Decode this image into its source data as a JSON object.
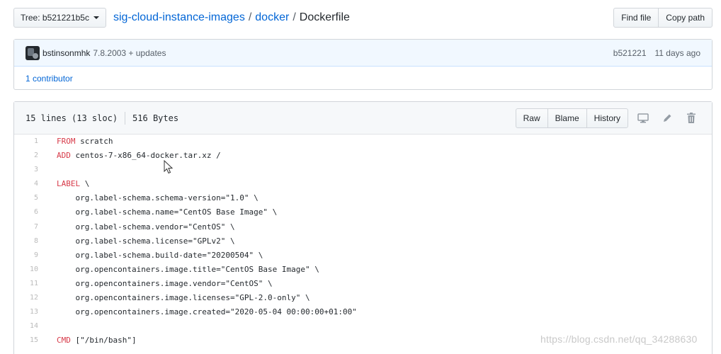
{
  "topbar": {
    "tree_label": "Tree: b521221b5c",
    "repo": "sig-cloud-instance-images",
    "dir": "docker",
    "file": "Dockerfile",
    "separator": "/",
    "find_file": "Find file",
    "copy_path": "Copy path"
  },
  "commit": {
    "author": "bstinsonmhk",
    "message": "7.8.2003 + updates",
    "sha": "b521221",
    "time": "11 days ago",
    "contributors": "1 contributor"
  },
  "file": {
    "lines_info": "15 lines (13 sloc)",
    "size": "516 Bytes",
    "raw": "Raw",
    "blame": "Blame",
    "history": "History",
    "icons": [
      "desktop-icon",
      "pencil-icon",
      "trash-icon"
    ]
  },
  "code_lines": [
    {
      "n": "1",
      "kw": "FROM",
      "rest": " scratch"
    },
    {
      "n": "2",
      "kw": "ADD",
      "rest": " centos-7-x86_64-docker.tar.xz /"
    },
    {
      "n": "3",
      "kw": "",
      "rest": ""
    },
    {
      "n": "4",
      "kw": "LABEL",
      "rest": " \\"
    },
    {
      "n": "5",
      "kw": "",
      "rest": "    org.label-schema.schema-version=\"1.0\" \\"
    },
    {
      "n": "6",
      "kw": "",
      "rest": "    org.label-schema.name=\"CentOS Base Image\" \\"
    },
    {
      "n": "7",
      "kw": "",
      "rest": "    org.label-schema.vendor=\"CentOS\" \\"
    },
    {
      "n": "8",
      "kw": "",
      "rest": "    org.label-schema.license=\"GPLv2\" \\"
    },
    {
      "n": "9",
      "kw": "",
      "rest": "    org.label-schema.build-date=\"20200504\" \\"
    },
    {
      "n": "10",
      "kw": "",
      "rest": "    org.opencontainers.image.title=\"CentOS Base Image\" \\"
    },
    {
      "n": "11",
      "kw": "",
      "rest": "    org.opencontainers.image.vendor=\"CentOS\" \\"
    },
    {
      "n": "12",
      "kw": "",
      "rest": "    org.opencontainers.image.licenses=\"GPL-2.0-only\" \\"
    },
    {
      "n": "13",
      "kw": "",
      "rest": "    org.opencontainers.image.created=\"2020-05-04 00:00:00+01:00\""
    },
    {
      "n": "14",
      "kw": "",
      "rest": ""
    },
    {
      "n": "15",
      "kw": "CMD",
      "rest": " [\"/bin/bash\"]"
    }
  ],
  "watermark": "https://blog.csdn.net/qq_34288630",
  "colors": {
    "link": "#0366d6",
    "keyword": "#d73a49",
    "commit_bg": "#f1f8ff"
  }
}
